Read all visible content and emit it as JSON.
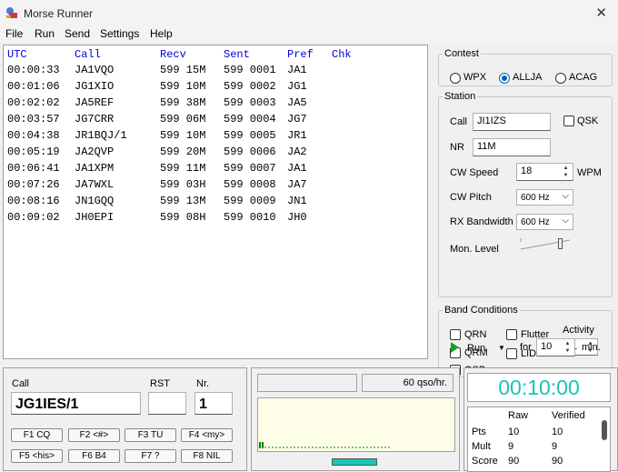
{
  "window": {
    "title": "Morse Runner"
  },
  "menu": [
    "File",
    "Run",
    "Send",
    "Settings",
    "Help"
  ],
  "log": {
    "headers": [
      "UTC",
      "Call",
      "Recv",
      "Sent",
      "Pref",
      "Chk"
    ],
    "rows": [
      [
        "00:00:33",
        "JA1VQO",
        "599 15M",
        "599 0001",
        "JA1",
        ""
      ],
      [
        "00:01:06",
        "JG1XIO",
        "599 10M",
        "599 0002",
        "JG1",
        ""
      ],
      [
        "00:02:02",
        "JA5REF",
        "599 38M",
        "599 0003",
        "JA5",
        ""
      ],
      [
        "00:03:57",
        "JG7CRR",
        "599 06M",
        "599 0004",
        "JG7",
        ""
      ],
      [
        "00:04:38",
        "JR1BQJ/1",
        "599 10M",
        "599 0005",
        "JR1",
        ""
      ],
      [
        "00:05:19",
        "JA2QVP",
        "599 20M",
        "599 0006",
        "JA2",
        ""
      ],
      [
        "00:06:41",
        "JA1XPM",
        "599 11M",
        "599 0007",
        "JA1",
        ""
      ],
      [
        "00:07:26",
        "JA7WXL",
        "599 03H",
        "599 0008",
        "JA7",
        ""
      ],
      [
        "00:08:16",
        "JN1GQQ",
        "599 13M",
        "599 0009",
        "JN1",
        ""
      ],
      [
        "00:09:02",
        "JH0EPI",
        "599 08H",
        "599 0010",
        "JH0",
        ""
      ]
    ]
  },
  "contest": {
    "legend": "Contest",
    "options": [
      "WPX",
      "ALLJA",
      "ACAG"
    ],
    "selected": "ALLJA"
  },
  "station": {
    "legend": "Station",
    "call_label": "Call",
    "call_value": "JI1IZS",
    "qsk_label": "QSK",
    "nr_label": "NR",
    "nr_value": "11M",
    "cw_speed_label": "CW Speed",
    "cw_speed_value": "18",
    "wpm_label": "WPM",
    "cw_pitch_label": "CW Pitch",
    "cw_pitch_value": "600 Hz",
    "rx_bw_label": "RX Bandwidth",
    "rx_bw_value": "600 Hz",
    "mon_level_label": "Mon. Level",
    "mon_level": 0.8
  },
  "band": {
    "legend": "Band Conditions",
    "qrn": "QRN",
    "flutter": "Flutter",
    "qrm": "QRM",
    "lids": "LID's",
    "qsb": "QSB",
    "activity_label": "Activity",
    "activity_value": "1"
  },
  "run": {
    "run_label": "Run",
    "for_label": "for",
    "minutes_value": "10",
    "min_label": "min."
  },
  "entry": {
    "call_label": "Call",
    "call_value": "JG1IES/1",
    "rst_label": "RST",
    "rst_value": "",
    "nr_label": "Nr.",
    "nr_value": "1"
  },
  "fkeys": [
    "F1 CQ",
    "F2 <#>",
    "F3 TU",
    "F4 <my>",
    "F5 <his>",
    "F6 B4",
    "F7 ?",
    "F8 NIL"
  ],
  "status": {
    "rate": "60 qso/hr."
  },
  "clock": "00:10:00",
  "score": {
    "col_raw": "Raw",
    "col_verified": "Verified",
    "rows": [
      {
        "label": "Pts",
        "raw": "10",
        "verified": "10"
      },
      {
        "label": "Mult",
        "raw": "9",
        "verified": "9"
      },
      {
        "label": "Score",
        "raw": "90",
        "verified": "90"
      }
    ]
  },
  "colors": {
    "link_blue": "#0000e0",
    "clock_cyan": "#18c6b4",
    "scope_bg": "#fefee8",
    "scope_signal": "#008000",
    "accent": "#0060c0"
  }
}
